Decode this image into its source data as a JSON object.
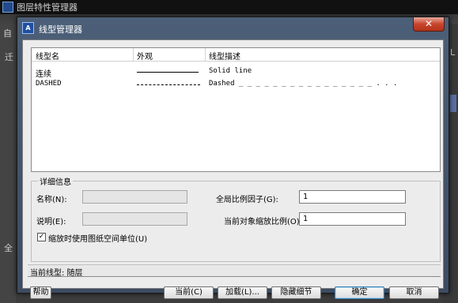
{
  "background_window": {
    "title": "图层特性管理器",
    "fragments": [
      "自",
      "迁",
      "全",
      "L"
    ]
  },
  "dialog": {
    "title": "线型管理器",
    "close_glyph": "✕"
  },
  "list": {
    "columns": [
      "线型名",
      "外观",
      "线型描述"
    ],
    "rows": [
      {
        "name": "连续",
        "appearance": "solid",
        "description": "Solid line"
      },
      {
        "name": "DASHED",
        "appearance": "dashed",
        "description": "Dashed _ _ _ _ _ _ _ _ _ _ _ _ _ _ _ _ . . ."
      }
    ]
  },
  "details": {
    "group_title": "详细信息",
    "name_label": "名称(N):",
    "name_value": "",
    "desc_label": "说明(E):",
    "desc_value": "",
    "global_scale_label": "全局比例因子(G):",
    "global_scale_value": "1",
    "current_scale_label": "当前对象缩放比例(O):",
    "current_scale_value": "1",
    "paper_space_label": "缩放时使用图纸空间单位(U)",
    "paper_space_checked": true
  },
  "current_linetype": {
    "text": "当前线型:  随层"
  },
  "buttons": {
    "help": "帮助",
    "current": "当前(C)",
    "load": "加载(L)...",
    "hide_details": "隐藏细节",
    "ok": "确定",
    "cancel": "取消"
  },
  "icons": {
    "app_icon": "autocad-icon",
    "check_glyph": "✓"
  }
}
